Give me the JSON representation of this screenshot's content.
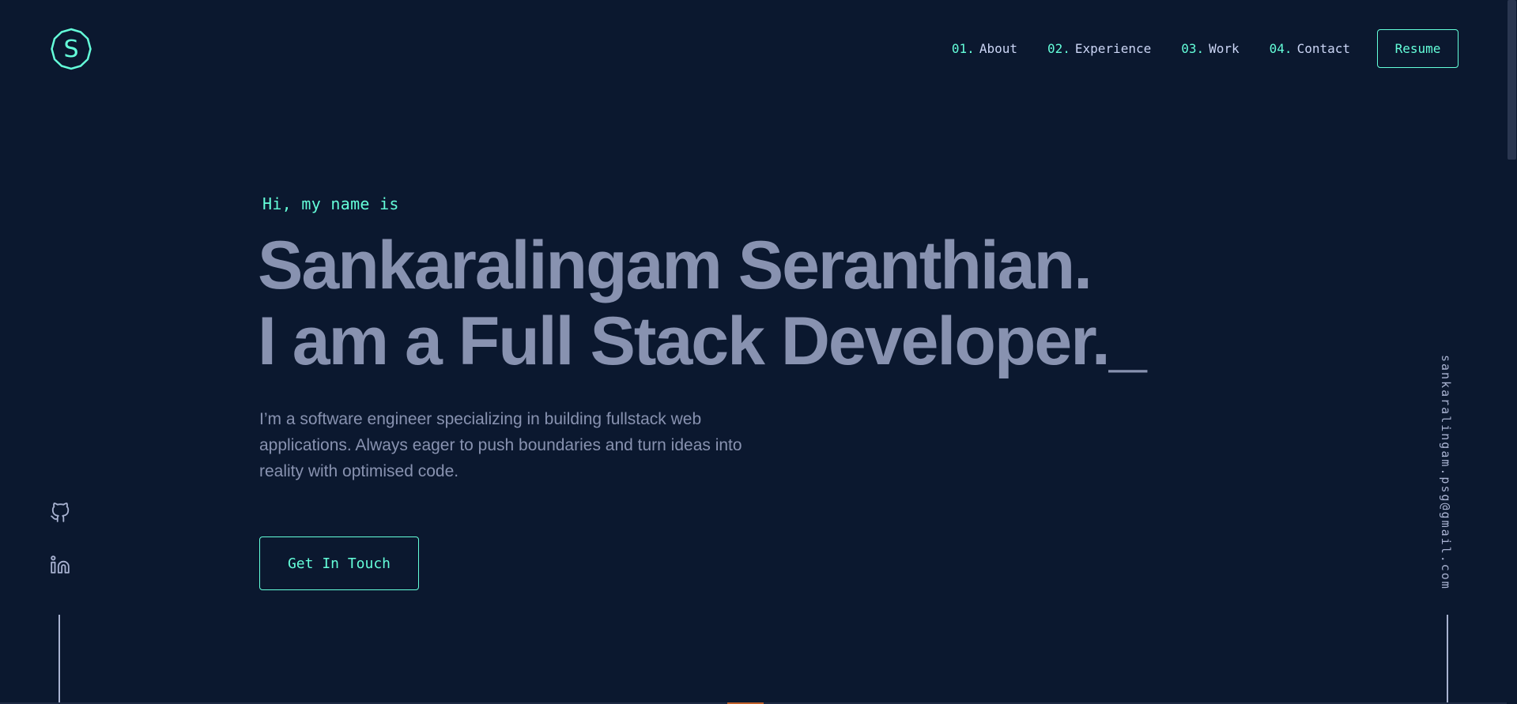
{
  "logo": {
    "letter": "S",
    "icon": "s-logo-icon"
  },
  "nav": {
    "items": [
      {
        "num": "01.",
        "label": "About"
      },
      {
        "num": "02.",
        "label": "Experience"
      },
      {
        "num": "03.",
        "label": "Work"
      },
      {
        "num": "04.",
        "label": "Contact"
      }
    ],
    "resume_label": "Resume"
  },
  "hero": {
    "greeting": "Hi, my name is",
    "name_line": "Sankaralingam Seranthian.",
    "role_line": "I am a Full Stack Developer.",
    "cursor": "_",
    "description": "I’m a software engineer specializing in building fullstack web applications. Always eager to push boundaries and turn ideas into reality with optimised code.",
    "cta_label": "Get In Touch"
  },
  "social": {
    "icons": [
      "github-icon",
      "linkedin-icon"
    ]
  },
  "email": "sankaralingam.psg@gmail.com",
  "colors": {
    "background": "#0b182f",
    "accent": "#64ffda",
    "text_light": "#ccd6f6",
    "text_muted": "#8892b0"
  }
}
